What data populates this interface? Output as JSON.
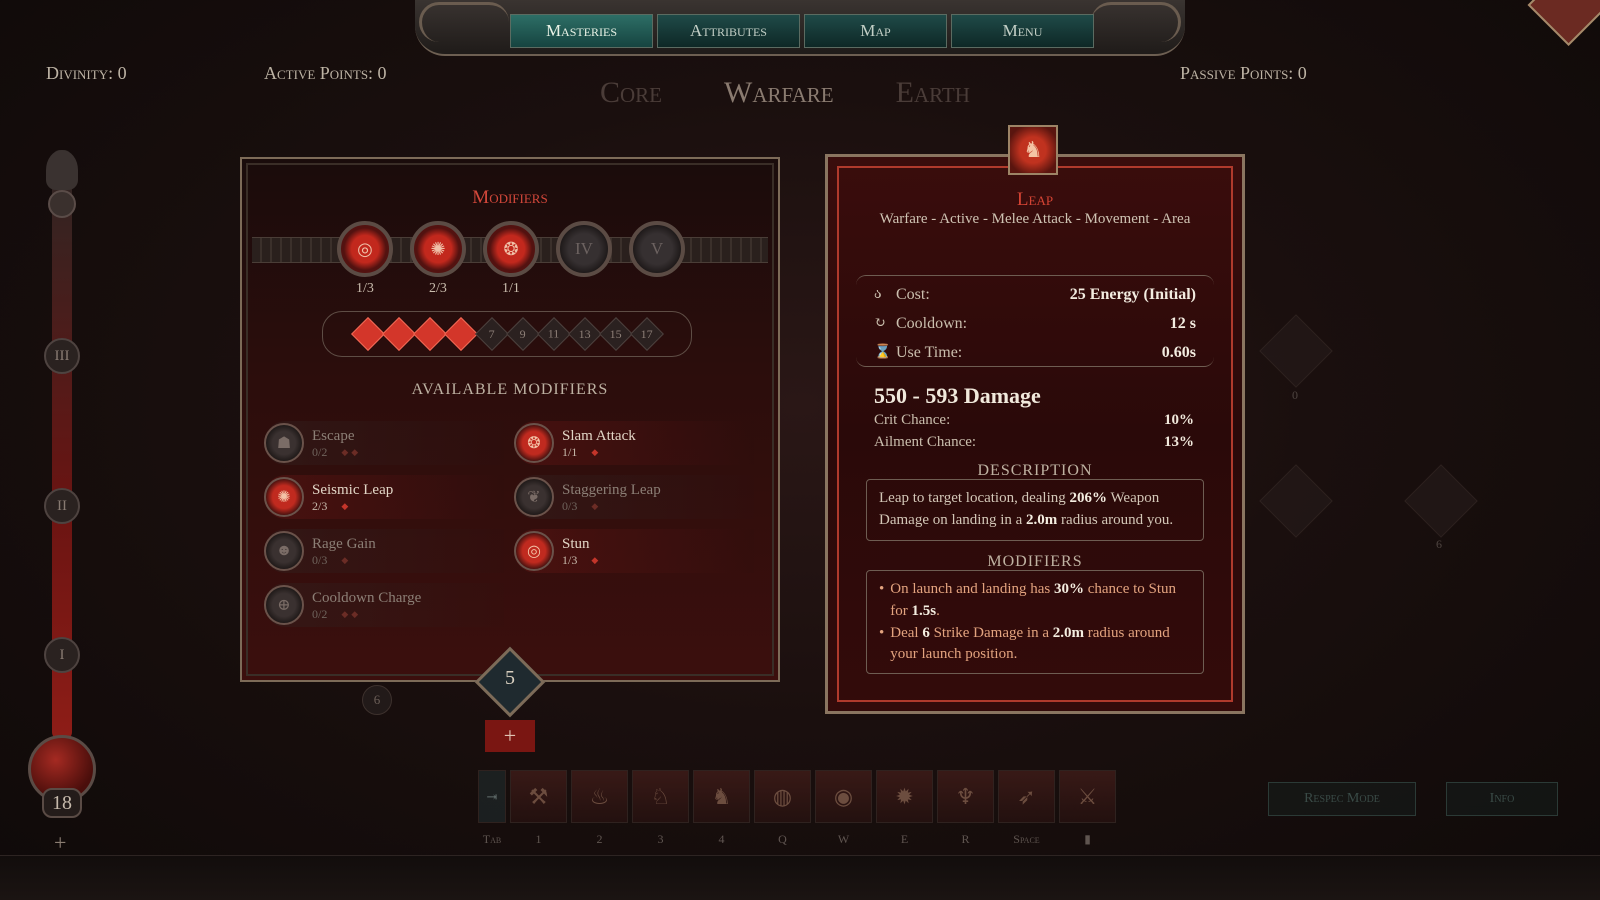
{
  "nav": {
    "tabs": [
      {
        "label": "Masteries",
        "active": true
      },
      {
        "label": "Attributes",
        "active": false
      },
      {
        "label": "Map",
        "active": false
      },
      {
        "label": "Menu",
        "active": false
      }
    ]
  },
  "counters": {
    "divinity": "Divinity: 0",
    "active_points": "Active Points: 0",
    "passive_points": "Passive Points: 0"
  },
  "mastery_tabs": [
    "Core",
    "Warfare",
    "Earth"
  ],
  "sidebar": {
    "nodes": [
      "III",
      "II",
      "I"
    ],
    "level": "18",
    "plus": "+"
  },
  "modifiers_panel": {
    "title": "Modifiers",
    "slots": [
      {
        "label": "",
        "count": "1/3",
        "locked": false
      },
      {
        "label": "",
        "count": "2/3",
        "locked": false
      },
      {
        "label": "",
        "count": "1/1",
        "locked": false
      },
      {
        "label": "IV",
        "count": "",
        "locked": true
      },
      {
        "label": "V",
        "count": "",
        "locked": true
      }
    ],
    "progress": {
      "filled": 4,
      "numbers": [
        "7",
        "9",
        "11",
        "13",
        "15",
        "17"
      ]
    },
    "available_title": "AVAILABLE MODIFIERS",
    "items": [
      {
        "name": "Escape",
        "count": "0/2",
        "pips": "◆◆",
        "active": false
      },
      {
        "name": "Slam Attack",
        "count": "1/1",
        "pips": "◆",
        "active": true
      },
      {
        "name": "Seismic Leap",
        "count": "2/3",
        "pips": "◆",
        "active": true
      },
      {
        "name": "Staggering Leap",
        "count": "0/3",
        "pips": "◆",
        "active": false
      },
      {
        "name": "Rage Gain",
        "count": "0/3",
        "pips": "◆",
        "active": false
      },
      {
        "name": "Stun",
        "count": "1/3",
        "pips": "◆",
        "active": true
      },
      {
        "name": "Cooldown Charge",
        "count": "0/2",
        "pips": "◆◆",
        "active": false
      }
    ],
    "points": "5",
    "plus": "+",
    "side_badge": "6"
  },
  "skill": {
    "title": "Leap",
    "tags": "Warfare - Active - Melee Attack - Movement - Area",
    "stats": [
      {
        "icon": "energy-icon",
        "label": "Cost:",
        "value": "25 Energy (Initial)"
      },
      {
        "icon": "cooldown-icon",
        "label": "Cooldown:",
        "value": "12 s"
      },
      {
        "icon": "hourglass-icon",
        "label": "Use Time:",
        "value": "0.60s"
      }
    ],
    "damage": "550 - 593 Damage",
    "crit_label": "Crit Chance:",
    "crit_value": "10%",
    "ailment_label": "Ailment Chance:",
    "ailment_value": "13%",
    "description_title": "DESCRIPTION",
    "description": {
      "p1": "Leap to target location, dealing ",
      "b1": "206%",
      "p2": " Weapon Damage on landing in a ",
      "b2": "2.0m",
      "p3": " radius around you."
    },
    "modifiers_title": "MODIFIERS",
    "mod_lines": [
      {
        "p1": "On launch and landing has ",
        "b1": "30%",
        "p2": " chance to Stun for ",
        "b2": "1.5s",
        "p3": "."
      },
      {
        "p1": "Deal ",
        "b1": "6",
        "p2": " Strike Damage in a ",
        "b2": "2.0m",
        "p3": " radius around your launch position."
      }
    ]
  },
  "skillbar": {
    "keys": [
      "Tab",
      "1",
      "2",
      "3",
      "4",
      "Q",
      "W",
      "E",
      "R",
      "Space",
      ""
    ]
  },
  "buttons": {
    "respec": "Respec Mode",
    "info": "Info"
  },
  "ghost_nodes": [
    "0",
    "6"
  ]
}
